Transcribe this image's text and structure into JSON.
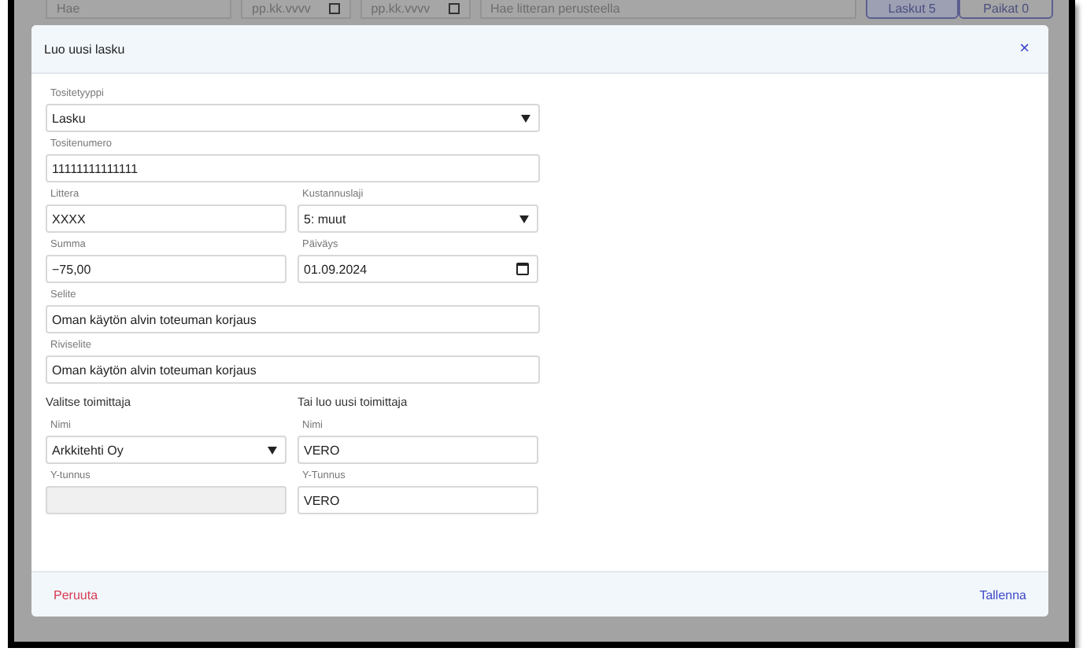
{
  "background_toolbar": {
    "search": {
      "placeholder": "Hae"
    },
    "date_fields": [
      {
        "placeholder": "pp.kk.vvvv"
      },
      {
        "placeholder": "pp.kk.vvvv"
      }
    ],
    "litter_search": {
      "placeholder": "Hae litteran perusteella"
    },
    "tabs": [
      {
        "label": "Laskut 5",
        "selected": true
      },
      {
        "label": "Paikat 0",
        "selected": false
      }
    ]
  },
  "dialog": {
    "title": "Luo uusi lasku",
    "close": "×",
    "rows": [
      {
        "cells": [
          {
            "kind": "select",
            "label": "Tositetyyppi",
            "value": "Lasku"
          }
        ]
      },
      {
        "cells": [
          {
            "kind": "text",
            "label": "Tositenumero",
            "value": "11111111111111"
          }
        ]
      },
      {
        "cells": [
          {
            "kind": "text",
            "label": "Littera",
            "value": "XXXX"
          },
          {
            "kind": "select",
            "label": "Kustannuslaji",
            "value": "5: muut"
          }
        ]
      },
      {
        "cells": [
          {
            "kind": "text",
            "label": "Summa",
            "value": "−75,00"
          },
          {
            "kind": "date",
            "label": "Päiväys",
            "value": "01.09.2024"
          }
        ]
      },
      {
        "cells": [
          {
            "kind": "text",
            "label": "Selite",
            "value": "Oman käytön alvin toteuman korjaus"
          }
        ]
      },
      {
        "cells": [
          {
            "kind": "text",
            "label": "Riviselite",
            "value": "Oman käytön alvin toteuman korjaus"
          }
        ]
      },
      {
        "cells": [
          {
            "kind": "heading",
            "label": "Valitse toimittaja"
          },
          {
            "kind": "heading",
            "label": "Tai luo uusi toimittaja"
          }
        ]
      },
      {
        "cells": [
          {
            "kind": "select",
            "label": "Nimi",
            "value": "Arkkitehti Oy"
          },
          {
            "kind": "text",
            "label": "Nimi",
            "value": "VERO"
          }
        ]
      },
      {
        "cells": [
          {
            "kind": "disabled",
            "label": "Y-tunnus"
          },
          {
            "kind": "text",
            "label": "Y-Tunnus",
            "value": "VERO"
          }
        ]
      }
    ],
    "cancel": "Peruuta",
    "save": "Tallenna"
  }
}
